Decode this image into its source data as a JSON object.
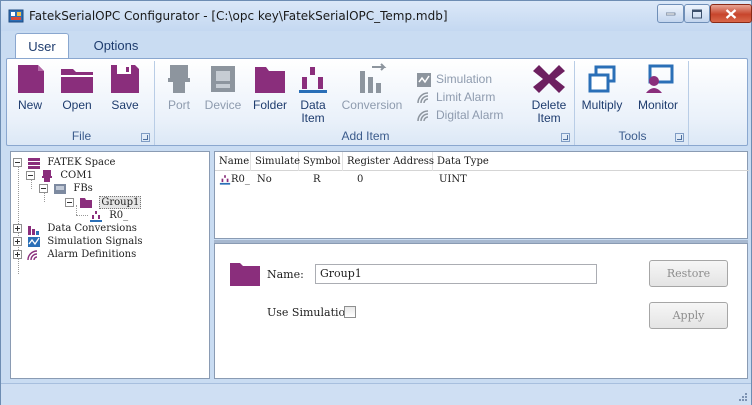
{
  "window": {
    "title": "FatekSerialOPC Configurator - [C:\\opc key\\FatekSerialOPC_Temp.mdb]",
    "icons": [
      "app-icon",
      "minimize-icon",
      "maximize-icon",
      "close-icon"
    ]
  },
  "ribbon_tabs": [
    {
      "label": "User",
      "active": true
    },
    {
      "label": "Options",
      "active": false
    }
  ],
  "ribbon": {
    "groups": {
      "file": {
        "label": "File"
      },
      "add_item": {
        "label": "Add Item"
      },
      "tools": {
        "label": "Tools"
      }
    },
    "buttons": {
      "new": {
        "label": "New",
        "icon": "new-document-icon"
      },
      "open": {
        "label": "Open",
        "icon": "open-folder-icon"
      },
      "save": {
        "label": "Save",
        "icon": "save-disk-icon"
      },
      "port": {
        "label": "Port",
        "icon": "port-icon",
        "enabled": false
      },
      "device": {
        "label": "Device",
        "icon": "device-icon",
        "enabled": false
      },
      "folder": {
        "label": "Folder",
        "icon": "folder-icon"
      },
      "data_item_1": "Data",
      "data_item_2": "Item",
      "conversion": {
        "label": "Conversion",
        "icon": "conversion-icon",
        "enabled": false
      },
      "simulation": {
        "label": "Simulation",
        "icon": "simulation-icon",
        "enabled": false
      },
      "limit_alarm": {
        "label": "Limit Alarm",
        "icon": "limit-alarm-icon",
        "enabled": false
      },
      "digital_alarm": {
        "label": "Digital Alarm",
        "icon": "digital-alarm-icon",
        "enabled": false
      },
      "delete_item_1": "Delete",
      "delete_item_2": "Item",
      "multiply": {
        "label": "Multiply",
        "icon": "multiply-icon"
      },
      "monitor": {
        "label": "Monitor",
        "icon": "monitor-icon"
      }
    }
  },
  "tree": {
    "nodes": [
      {
        "label": "FATEK Space",
        "icon": "database-icon"
      },
      {
        "label": "COM1",
        "icon": "serial-port-icon"
      },
      {
        "label": "FBs",
        "icon": "plc-device-icon"
      },
      {
        "label": "Group1",
        "icon": "folder-icon",
        "selected": true
      },
      {
        "label": "R0_",
        "icon": "data-item-icon"
      },
      {
        "label": "Data Conversions",
        "icon": "conversion-icon"
      },
      {
        "label": "Simulation Signals",
        "icon": "simulation-icon"
      },
      {
        "label": "Alarm Definitions",
        "icon": "alarm-icon"
      }
    ]
  },
  "item_list": {
    "columns": [
      "Name",
      "Simulate",
      "Symbol",
      "Register Address",
      "Data Type"
    ],
    "rows": [
      {
        "name": "R0_",
        "simulate": "No",
        "symbol": "R",
        "register_address": "0",
        "data_type": "UINT"
      }
    ]
  },
  "detail": {
    "name_label": "Name:",
    "name_value": "Group1",
    "use_simulation_label": "Use Simulation:",
    "use_simulation_checked": false,
    "restore_label": "Restore",
    "apply_label": "Apply"
  },
  "colors": {
    "accent_purple": "#8a2e7c",
    "icon_blue": "#2a6fb7",
    "delete_red": "#6d2060",
    "window_frame": "#c9dcf2"
  }
}
